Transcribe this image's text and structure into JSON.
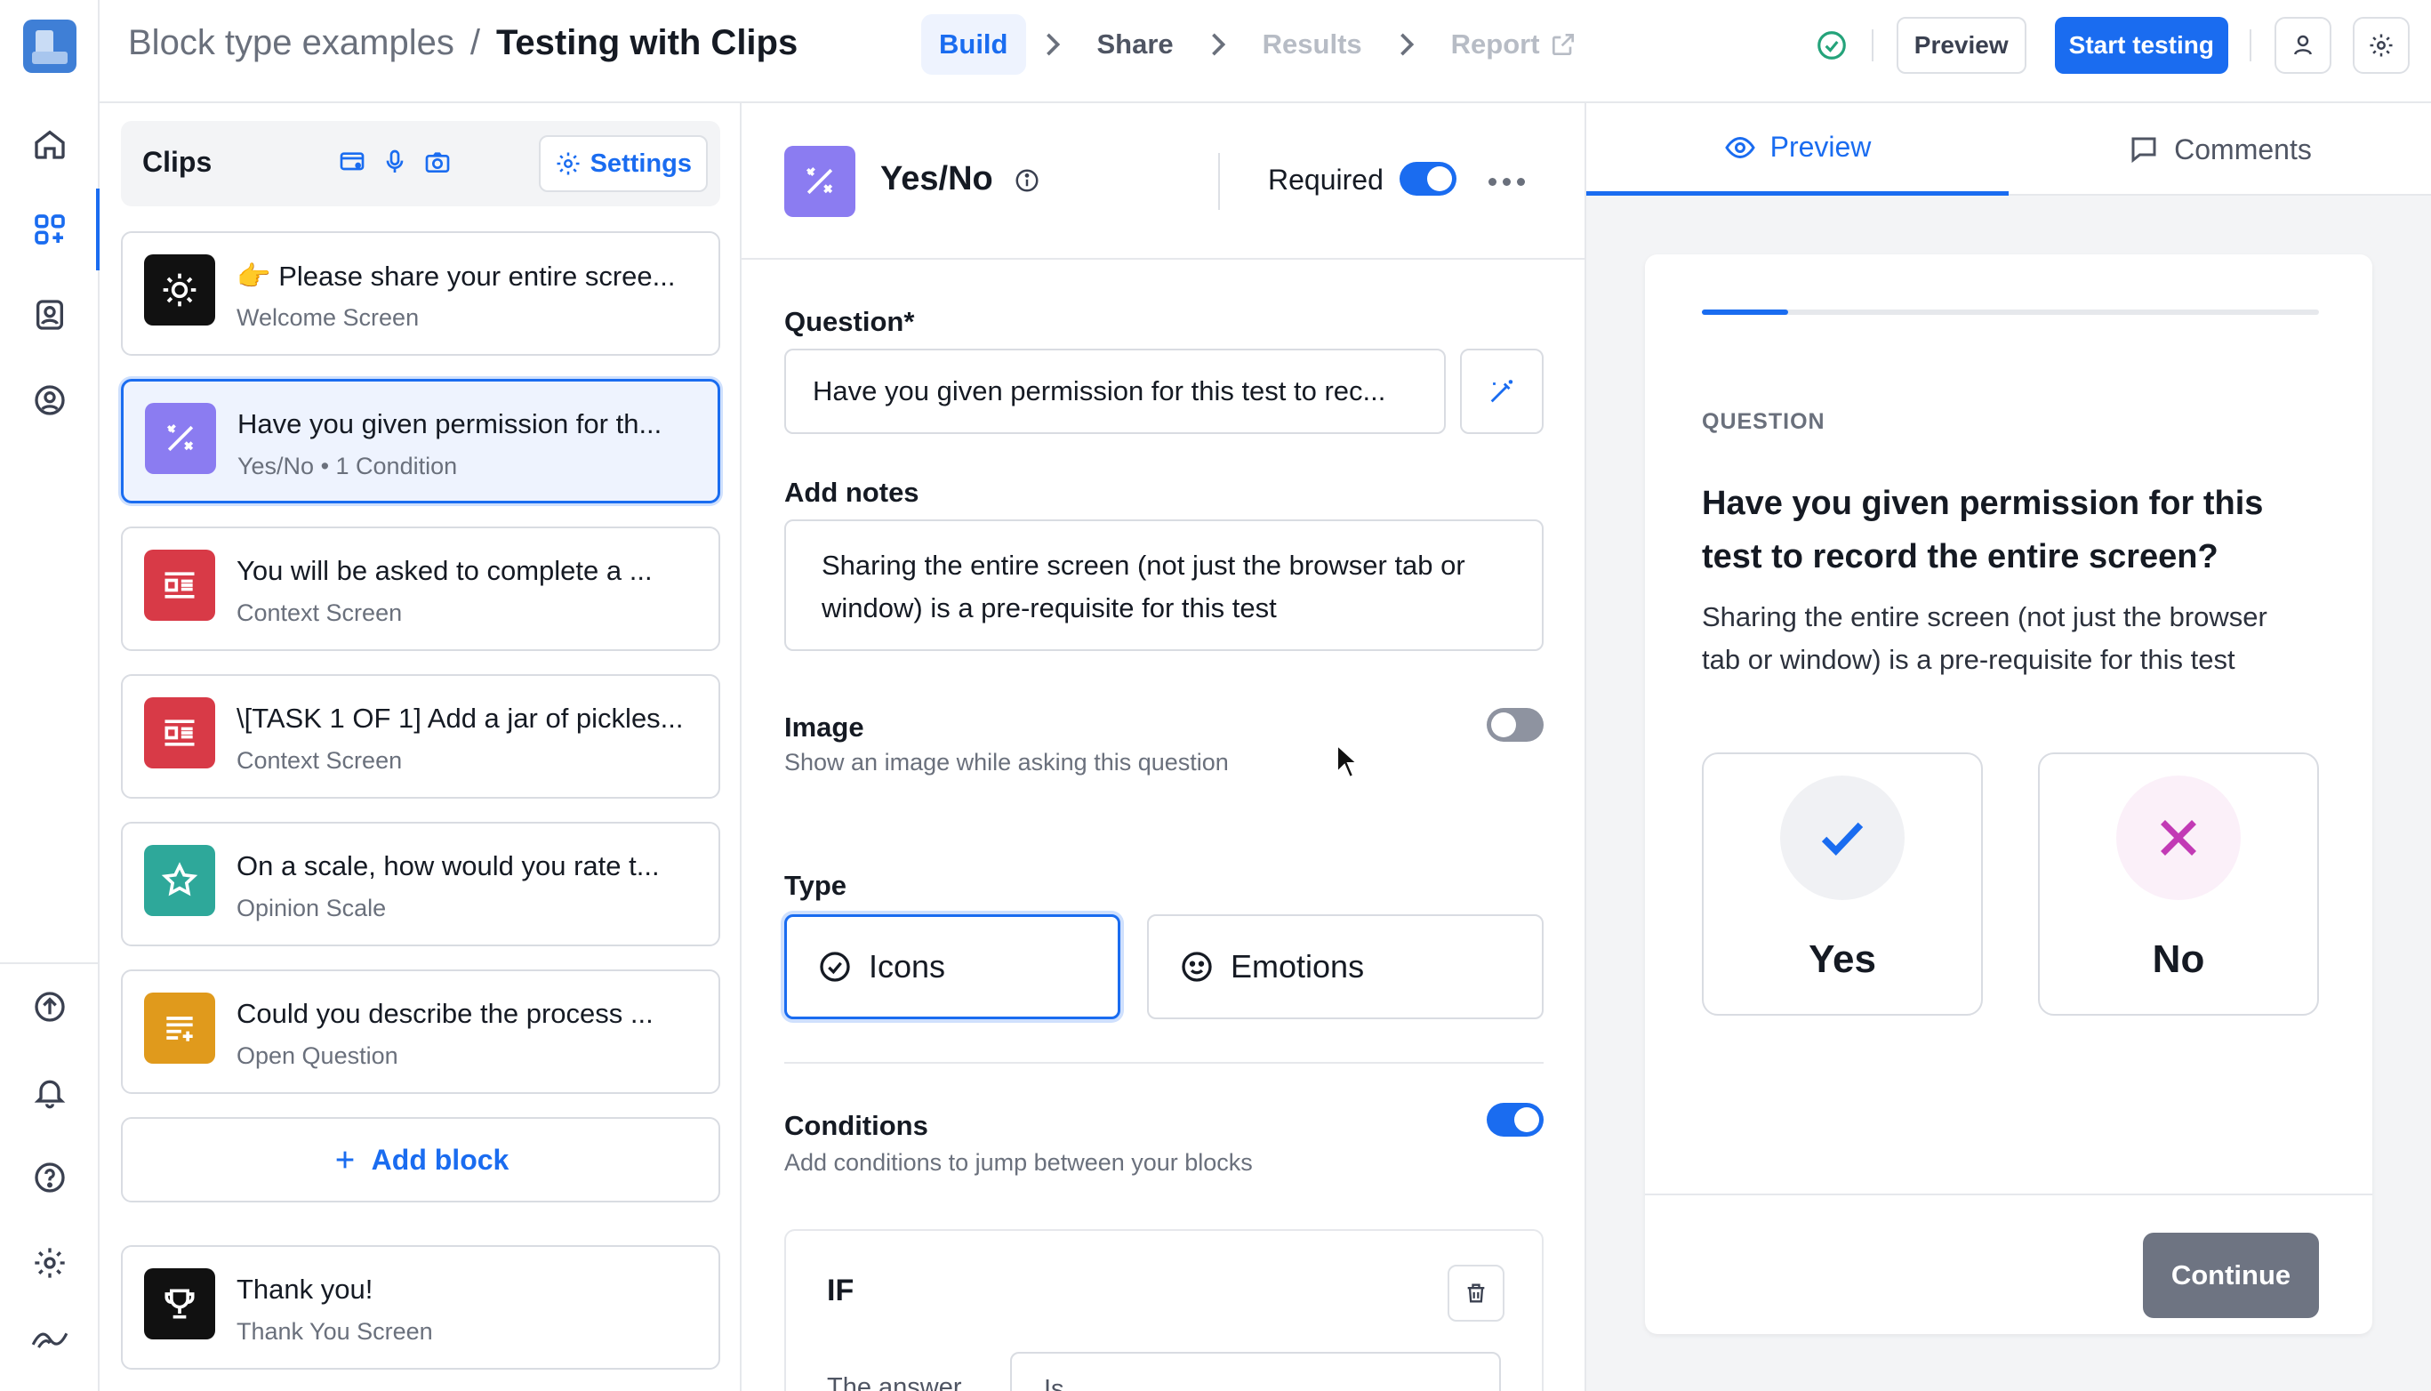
{
  "breadcrumb": {
    "parent": "Block type examples",
    "separator": "/",
    "title": "Testing with Clips"
  },
  "steps": [
    {
      "label": "Build",
      "state": "active"
    },
    {
      "label": "Share",
      "state": "done"
    },
    {
      "label": "Results",
      "state": "disabled"
    },
    {
      "label": "Report",
      "state": "disabled"
    }
  ],
  "header_actions": {
    "preview_label": "Preview",
    "start_label": "Start testing"
  },
  "clips_panel": {
    "title": "Clips",
    "settings_label": "Settings",
    "add_block_label": "Add block",
    "items": [
      {
        "title": "👉 Please share your entire scree...",
        "subtitle": "Welcome Screen",
        "icon": "sun-icon",
        "color": "#111111"
      },
      {
        "title": "Have you given permission for th...",
        "subtitle": "Yes/No • 1 Condition",
        "icon": "percent-icon",
        "color": "#8b7cf1",
        "selected": true
      },
      {
        "title": "You will be asked to complete a ...",
        "subtitle": "Context Screen",
        "icon": "context-icon",
        "color": "#d83a47"
      },
      {
        "title": "\\[TASK 1 OF 1] Add a jar of pickles...",
        "subtitle": "Context Screen",
        "icon": "context-icon",
        "color": "#d83a47"
      },
      {
        "title": "On a scale, how would you rate t...",
        "subtitle": "Opinion Scale",
        "icon": "star-icon",
        "color": "#2ea89a"
      },
      {
        "title": "Could you describe the process ...",
        "subtitle": "Open Question",
        "icon": "text-icon",
        "color": "#e09a1c"
      }
    ],
    "thank_you": {
      "title": "Thank you!",
      "subtitle": "Thank You Screen",
      "icon": "trophy-icon",
      "color": "#111111"
    }
  },
  "editor": {
    "block_name": "Yes/No",
    "required_label": "Required",
    "required": true,
    "question_label": "Question*",
    "question_value": "Have you given permission for this test to rec...",
    "notes_label": "Add notes",
    "notes_value": "Sharing the entire screen (not just the browser tab or window) is a pre-requisite for this test",
    "image_label": "Image",
    "image_hint": "Show an image while asking this question",
    "image_enabled": false,
    "type_label": "Type",
    "type_options": [
      "Icons",
      "Emotions"
    ],
    "type_selected": "Icons",
    "conditions_label": "Conditions",
    "conditions_hint": "Add conditions to jump between your blocks",
    "conditions_enabled": true,
    "if_label": "IF",
    "answer_label": "The answer",
    "answer_select": "Is..."
  },
  "preview": {
    "tabs": [
      "Preview",
      "Comments"
    ],
    "active_tab": "Preview",
    "progress": 0.14,
    "question_label": "QUESTION",
    "question_title": "Have you given permission for this test to record the entire screen?",
    "question_notes": "Sharing the entire screen (not just the browser tab or window) is a pre-requisite for this test",
    "answers": [
      {
        "label": "Yes",
        "icon": "check-icon",
        "color": "#1a6cf0"
      },
      {
        "label": "No",
        "icon": "x-icon",
        "color": "#c23ab5"
      }
    ],
    "continue_label": "Continue"
  },
  "colors": {
    "accent": "#1a6cf0",
    "success": "#24a37a"
  }
}
